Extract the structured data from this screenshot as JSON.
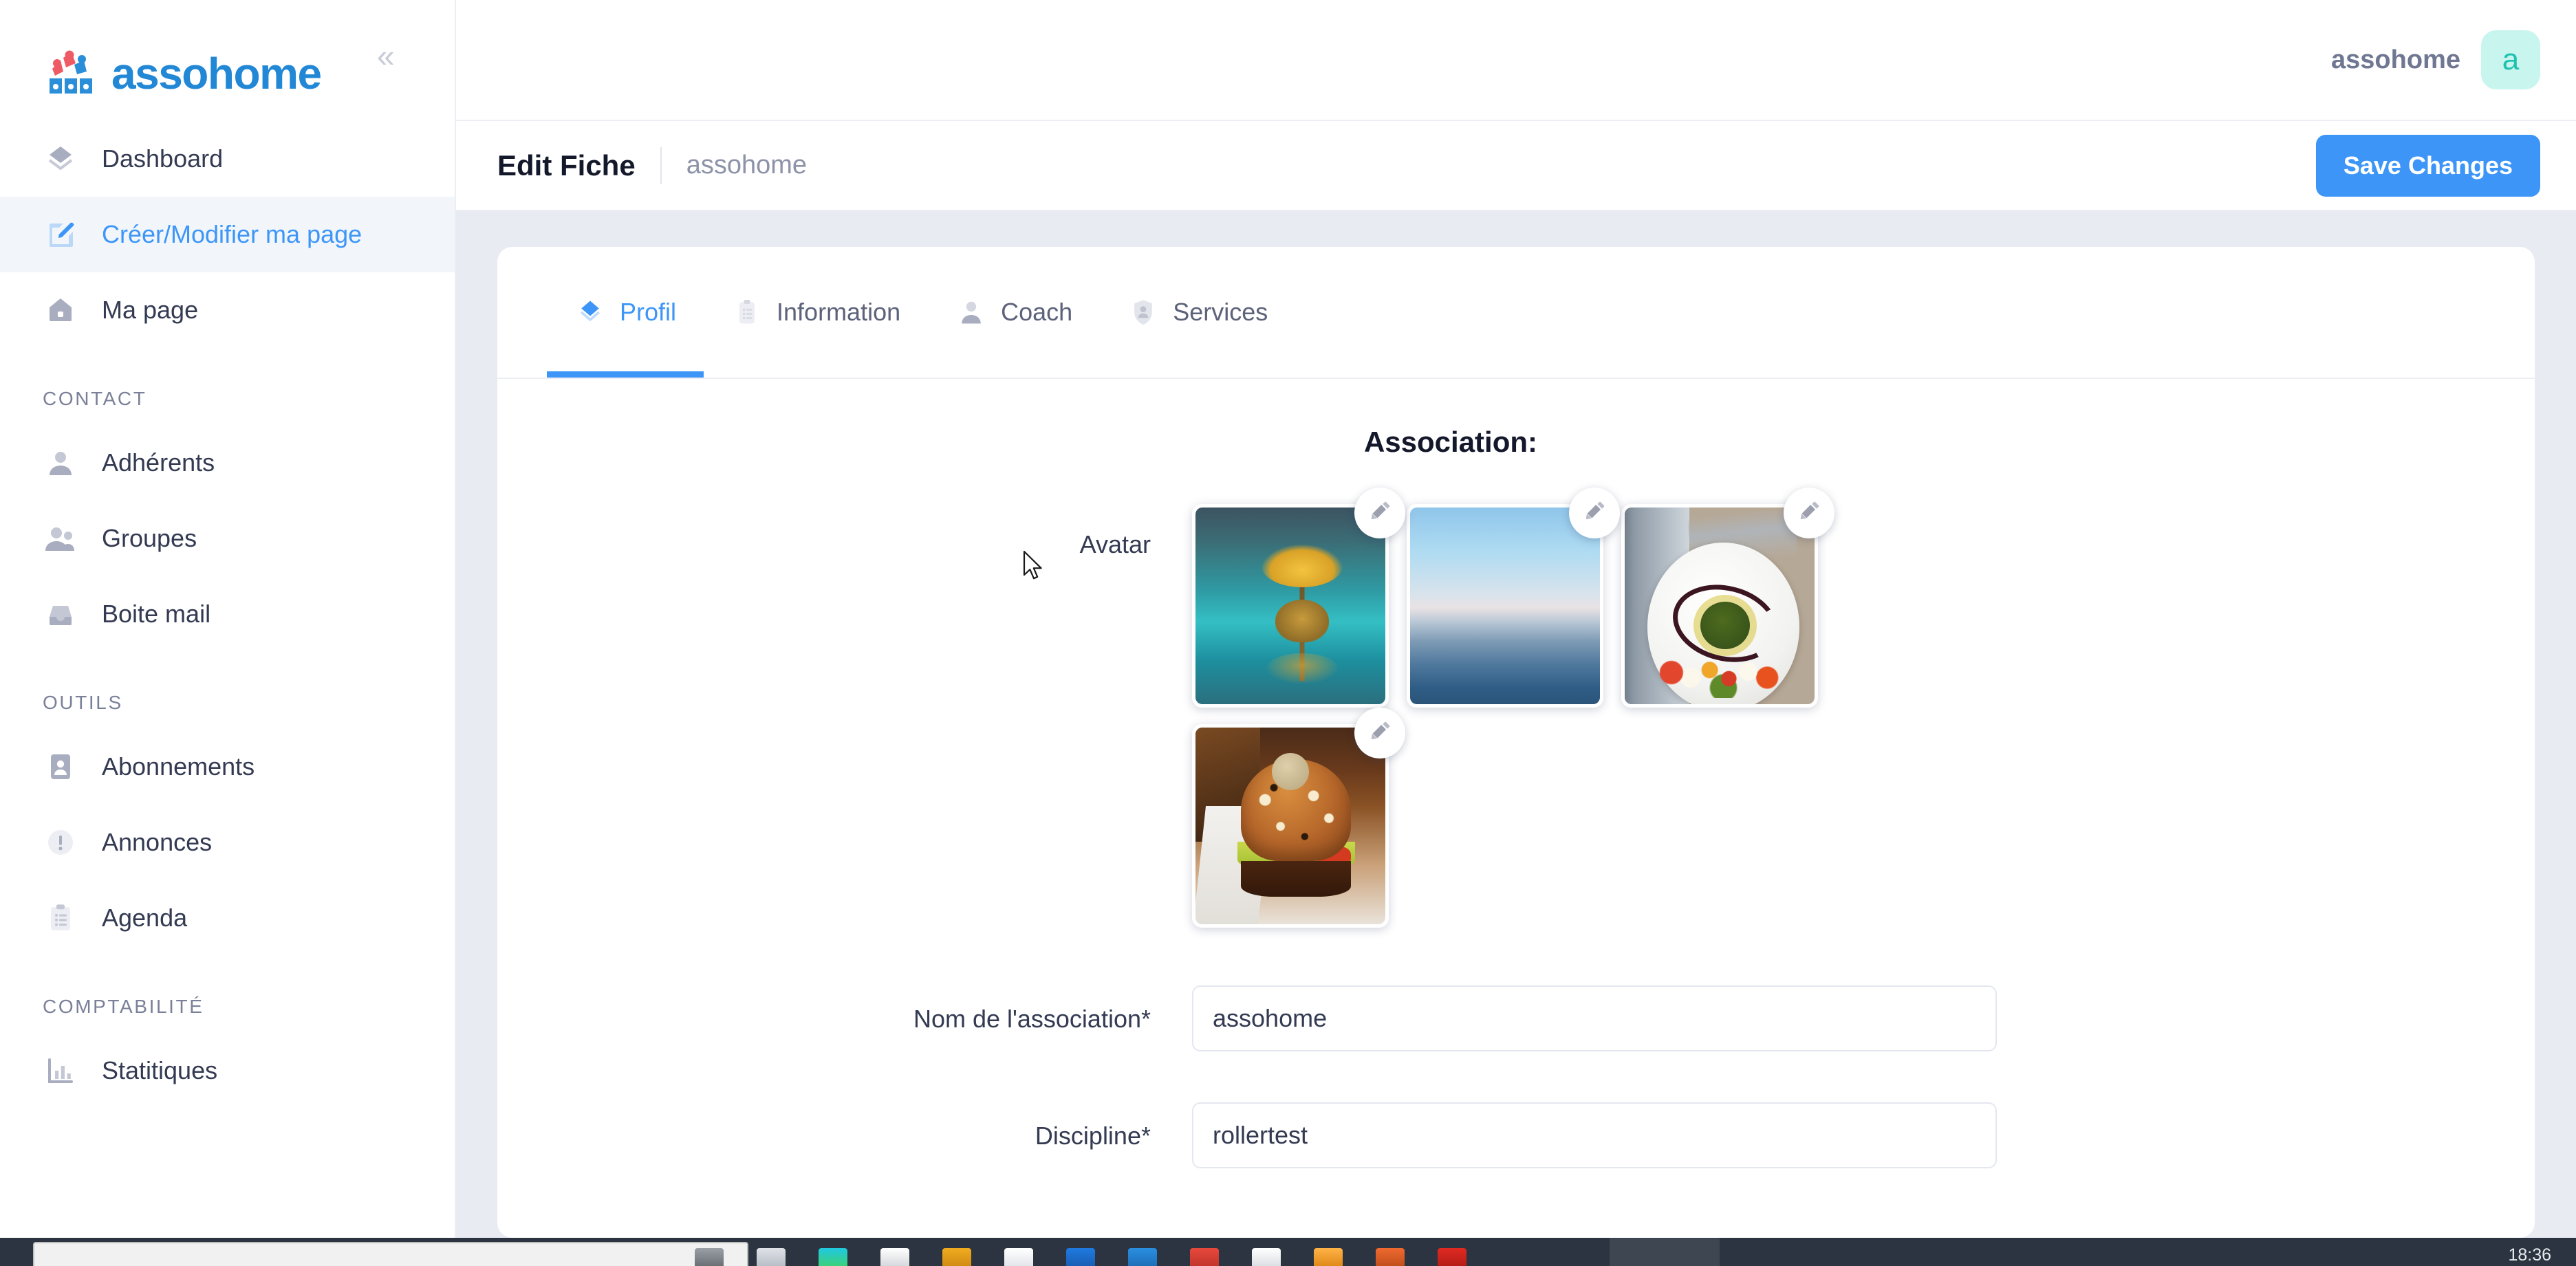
{
  "brand": {
    "logo_text": "assohome",
    "logo_color": "#2288d6",
    "collapse_icon": "chevron-double-left-icon"
  },
  "sidebar": {
    "items": [
      {
        "label": "Dashboard",
        "icon": "dashboard-diamond-icon",
        "active": false
      },
      {
        "label": "Créer/Modifier ma page",
        "icon": "edit-square-icon",
        "active": true
      },
      {
        "label": "Ma page",
        "icon": "home-icon",
        "active": false
      }
    ],
    "sections": [
      {
        "title": "CONTACT",
        "items": [
          {
            "label": "Adhérents",
            "icon": "person-icon"
          },
          {
            "label": "Groupes",
            "icon": "people-group-icon"
          },
          {
            "label": "Boite mail",
            "icon": "inbox-icon"
          }
        ]
      },
      {
        "title": "OUTILS",
        "items": [
          {
            "label": "Abonnements",
            "icon": "id-card-icon"
          },
          {
            "label": "Annonces",
            "icon": "exclamation-circle-icon"
          },
          {
            "label": "Agenda",
            "icon": "clipboard-list-icon"
          }
        ]
      },
      {
        "title": "COMPTABILITÉ",
        "items": [
          {
            "label": "Statitiques",
            "icon": "bar-chart-icon"
          }
        ]
      }
    ]
  },
  "topbar": {
    "user_name": "assohome",
    "avatar_letter": "a",
    "avatar_bg": "#c9f5ef",
    "avatar_fg": "#1fc2ae"
  },
  "breadcrumb": {
    "title": "Edit Fiche",
    "subtitle": "assohome",
    "save_label": "Save Changes",
    "save_color": "#3d96f7"
  },
  "tabs": [
    {
      "label": "Profil",
      "icon": "diamond-icon",
      "active": true
    },
    {
      "label": "Information",
      "icon": "clipboard-icon",
      "active": false
    },
    {
      "label": "Coach",
      "icon": "person-icon",
      "active": false
    },
    {
      "label": "Services",
      "icon": "shield-person-icon",
      "active": false
    }
  ],
  "form": {
    "heading": "Association:",
    "avatar_label": "Avatar",
    "avatars": [
      {
        "alt": "lake-tree-photo",
        "art": "img-lake"
      },
      {
        "alt": "ocean-horizon-photo",
        "art": "img-ocean"
      },
      {
        "alt": "plated-salad-photo",
        "art": "img-plate"
      },
      {
        "alt": "burger-photo",
        "art": "img-burger"
      }
    ],
    "edit_icon": "pencil-icon",
    "fields": [
      {
        "label": "Nom de l'association*",
        "value": "assohome",
        "placeholder": ""
      },
      {
        "label": "Discipline*",
        "value": "rollertest",
        "placeholder": ""
      }
    ]
  },
  "taskbar": {
    "clock": "18:36"
  }
}
